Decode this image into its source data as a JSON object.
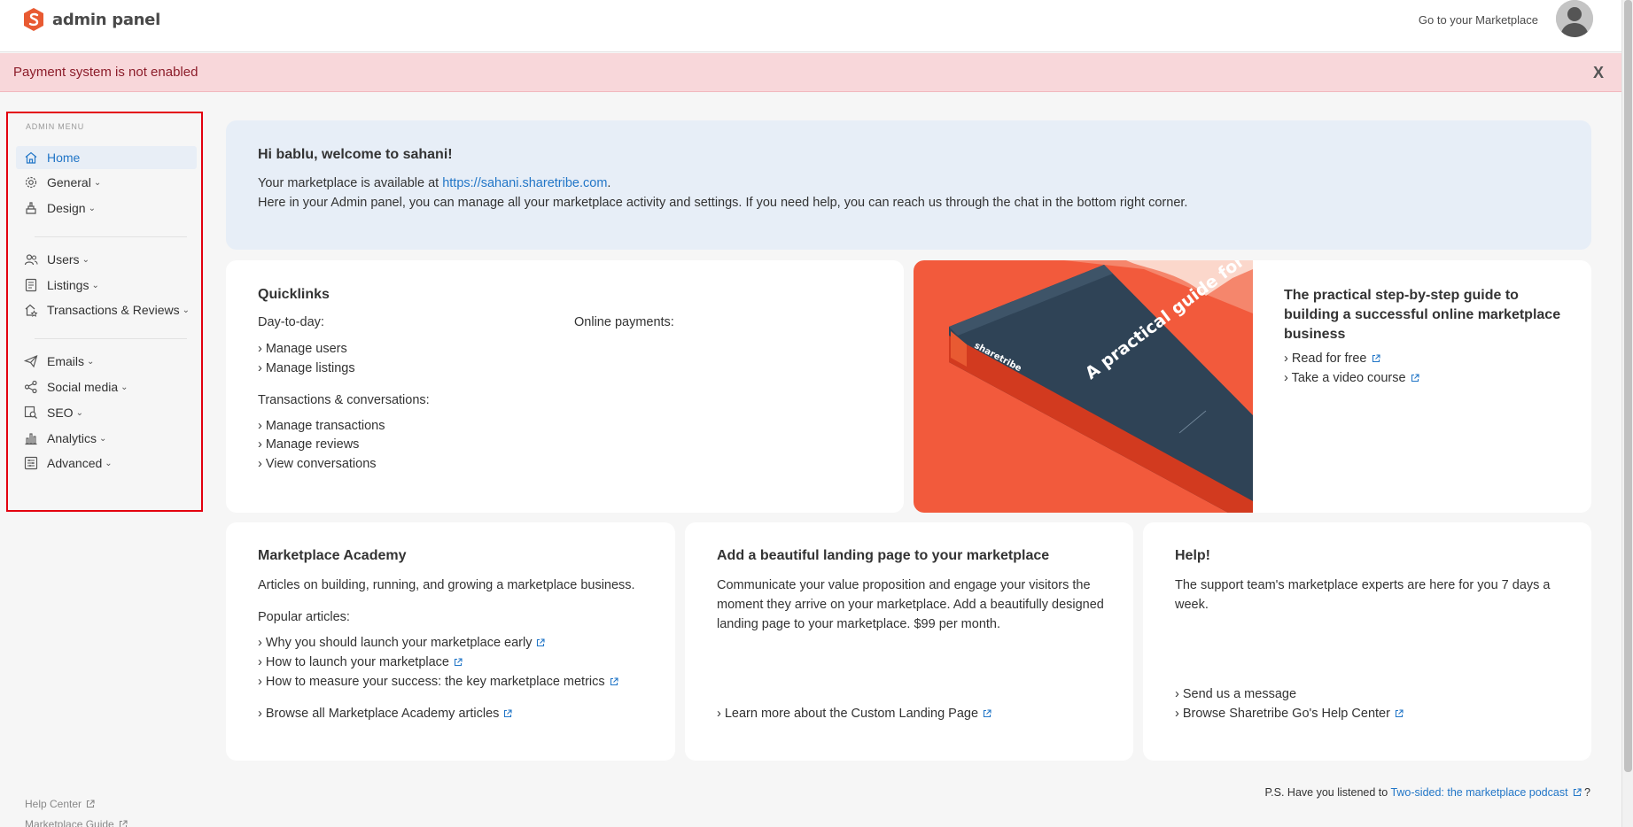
{
  "header": {
    "logo_text": "admin panel",
    "go_to_marketplace": "Go to your Marketplace"
  },
  "alert": {
    "message": "Payment system is not enabled",
    "close": "X"
  },
  "sidebar": {
    "title": "ADMIN MENU",
    "items": [
      {
        "label": "Home",
        "icon": "home-icon"
      },
      {
        "label": "General",
        "icon": "gear-icon"
      },
      {
        "label": "Design",
        "icon": "paint-bucket-icon"
      },
      {
        "label": "Users",
        "icon": "users-icon"
      },
      {
        "label": "Listings",
        "icon": "listings-icon"
      },
      {
        "label": "Transactions & Reviews",
        "icon": "transactions-icon"
      },
      {
        "label": "Emails",
        "icon": "paper-plane-icon"
      },
      {
        "label": "Social media",
        "icon": "share-icon"
      },
      {
        "label": "SEO",
        "icon": "seo-icon"
      },
      {
        "label": "Analytics",
        "icon": "bar-chart-icon"
      },
      {
        "label": "Advanced",
        "icon": "sliders-icon"
      }
    ],
    "footer": [
      "Help Center",
      "Marketplace Guide"
    ]
  },
  "welcome": {
    "title": "Hi bablu, welcome to sahani!",
    "line1_prefix": "Your marketplace is available at ",
    "url": "https://sahani.sharetribe.com",
    "line1_suffix": ".",
    "line2": "Here in your Admin panel, you can manage all your marketplace activity and settings. If you need help, you can reach us through the chat in the bottom right corner."
  },
  "quicklinks": {
    "title": "Quicklinks",
    "day_to_day": "Day-to-day:",
    "online_payments": "Online payments:",
    "manage_users": "› Manage users",
    "manage_listings": "› Manage listings",
    "transactions_heading": "Transactions & conversations:",
    "manage_transactions": "› Manage transactions",
    "manage_reviews": "› Manage reviews",
    "view_conversations": "› View conversations"
  },
  "guide": {
    "book_title": "A practical guide for building an online marketplace business",
    "book_brand": "sharetribe",
    "title": "The practical step-by-step guide to building a successful online marketplace business",
    "read_free": "› Read for free",
    "video_course": "› Take a video course"
  },
  "academy": {
    "title": "Marketplace Academy",
    "desc": "Articles on building, running, and growing a marketplace business.",
    "popular": "Popular articles:",
    "articles": [
      "› Why you should launch your marketplace early",
      "› How to launch your marketplace",
      "› How to measure your success: the key marketplace metrics"
    ],
    "browse_all": "› Browse all Marketplace Academy articles"
  },
  "landing": {
    "title": "Add a beautiful landing page to your marketplace",
    "desc": "Communicate your value proposition and engage your visitors the moment they arrive on your marketplace. Add a beautifully designed landing page to your marketplace. $99 per month.",
    "learn_more": "› Learn more about the Custom Landing Page"
  },
  "help": {
    "title": "Help!",
    "desc": "The support team's marketplace experts are here for you 7 days a week.",
    "send_message": "› Send us a message",
    "browse_help": "› Browse Sharetribe Go's Help Center"
  },
  "footer": {
    "podcast_prefix": "P.S. Have you listened to ",
    "podcast_link": "Two-sided: the marketplace podcast",
    "podcast_suffix": " ?"
  },
  "colors": {
    "brand": "#e85a32",
    "link": "#2276c7",
    "alert_bg": "#f8d7da",
    "highlight_border": "#e3000f"
  }
}
